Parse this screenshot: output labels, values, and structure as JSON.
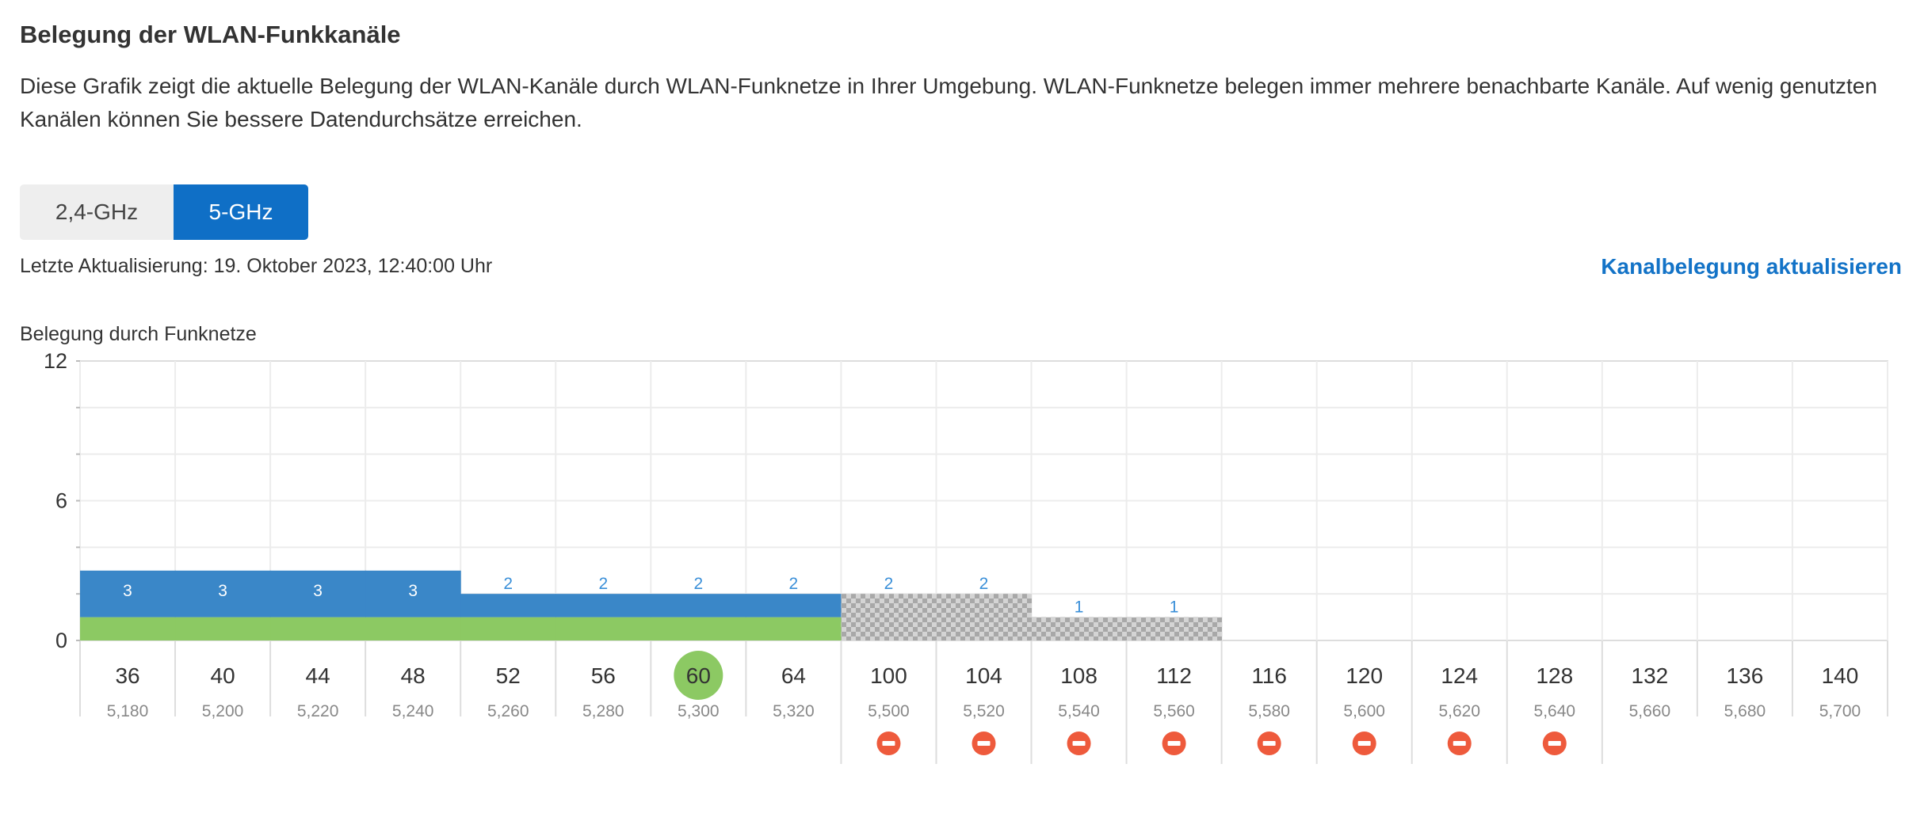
{
  "header": {
    "title": "Belegung der WLAN-Funkkanäle",
    "description": "Diese Grafik zeigt die aktuelle Belegung der WLAN-Kanäle durch WLAN-Funknetze in Ihrer Umgebung. WLAN-Funknetze belegen immer mehrere benachbarte Kanäle. Auf wenig genutzten Kanälen können Sie bessere Datendurchsätze erreichen."
  },
  "band_switch": {
    "option_24": "2,4-GHz",
    "option_5": "5-GHz",
    "selected": "5-GHz"
  },
  "status": {
    "last_update": "Letzte Aktualisierung: 19. Oktober 2023, 12:40:00 Uhr",
    "refresh_label": "Kanalbelegung aktualisieren"
  },
  "colors": {
    "accent": "#0f6fc6",
    "bar_blue": "#3a87c8",
    "own_network_green": "#8cc963",
    "blocked_red": "#ee5a3c",
    "dfs_gray": "#bdbdbd",
    "label_blue": "#3a8fd8"
  },
  "chart_data": {
    "type": "bar",
    "title": "Belegung durch Funknetze",
    "ylim": [
      0,
      12
    ],
    "yticks": [
      0,
      6,
      12
    ],
    "grid": true,
    "channels": [
      {
        "ch": "36",
        "freq": "5,180",
        "count": 3,
        "own": true,
        "dfs": false,
        "blocked": false
      },
      {
        "ch": "40",
        "freq": "5,200",
        "count": 3,
        "own": true,
        "dfs": false,
        "blocked": false
      },
      {
        "ch": "44",
        "freq": "5,220",
        "count": 3,
        "own": true,
        "dfs": false,
        "blocked": false
      },
      {
        "ch": "48",
        "freq": "5,240",
        "count": 3,
        "own": true,
        "dfs": false,
        "blocked": false
      },
      {
        "ch": "52",
        "freq": "5,260",
        "count": 2,
        "own": true,
        "dfs": false,
        "blocked": false
      },
      {
        "ch": "56",
        "freq": "5,280",
        "count": 2,
        "own": true,
        "dfs": false,
        "blocked": false
      },
      {
        "ch": "60",
        "freq": "5,300",
        "count": 2,
        "own": true,
        "dfs": false,
        "blocked": false,
        "current": true
      },
      {
        "ch": "64",
        "freq": "5,320",
        "count": 2,
        "own": true,
        "dfs": false,
        "blocked": false
      },
      {
        "ch": "100",
        "freq": "5,500",
        "count": 2,
        "own": false,
        "dfs": true,
        "blocked": true
      },
      {
        "ch": "104",
        "freq": "5,520",
        "count": 2,
        "own": false,
        "dfs": true,
        "blocked": true
      },
      {
        "ch": "108",
        "freq": "5,540",
        "count": 1,
        "own": false,
        "dfs": true,
        "blocked": true
      },
      {
        "ch": "112",
        "freq": "5,560",
        "count": 1,
        "own": false,
        "dfs": true,
        "blocked": true
      },
      {
        "ch": "116",
        "freq": "5,580",
        "count": 0,
        "own": false,
        "dfs": false,
        "blocked": true
      },
      {
        "ch": "120",
        "freq": "5,600",
        "count": 0,
        "own": false,
        "dfs": false,
        "blocked": true
      },
      {
        "ch": "124",
        "freq": "5,620",
        "count": 0,
        "own": false,
        "dfs": false,
        "blocked": true
      },
      {
        "ch": "128",
        "freq": "5,640",
        "count": 0,
        "own": false,
        "dfs": false,
        "blocked": true
      },
      {
        "ch": "132",
        "freq": "5,660",
        "count": 0,
        "own": false,
        "dfs": false,
        "blocked": false
      },
      {
        "ch": "136",
        "freq": "5,680",
        "count": 0,
        "own": false,
        "dfs": false,
        "blocked": false
      },
      {
        "ch": "140",
        "freq": "5,700",
        "count": 0,
        "own": false,
        "dfs": false,
        "blocked": false
      }
    ]
  }
}
